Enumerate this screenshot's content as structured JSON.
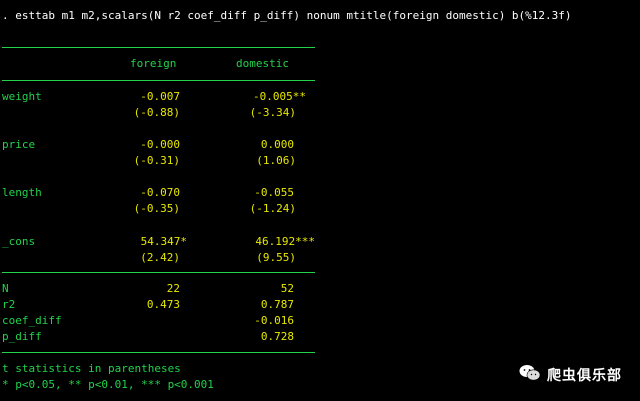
{
  "command": ". esttab m1 m2,scalars(N r2 coef_diff p_diff) nonum mtitle(foreign domestic) b(%12.3f)",
  "columns": [
    "foreign",
    "domestic"
  ],
  "rows": [
    {
      "name": "weight",
      "coef": [
        "-0.007",
        "-0.005**"
      ],
      "tstat": [
        "(-0.88)",
        "(-3.34)"
      ]
    },
    {
      "name": "price",
      "coef": [
        "-0.000",
        "0.000"
      ],
      "tstat": [
        "(-0.31)",
        "(1.06)"
      ]
    },
    {
      "name": "length",
      "coef": [
        "-0.070",
        "-0.055"
      ],
      "tstat": [
        "(-0.35)",
        "(-1.24)"
      ]
    },
    {
      "name": "_cons",
      "coef": [
        "54.347*",
        "46.192***"
      ],
      "tstat": [
        "(2.42)",
        "(9.55)"
      ]
    }
  ],
  "scalars": [
    {
      "name": "N",
      "values": [
        "22",
        "52"
      ]
    },
    {
      "name": "r2",
      "values": [
        "0.473",
        "0.787"
      ]
    },
    {
      "name": "coef_diff",
      "values": [
        "",
        "-0.016"
      ]
    },
    {
      "name": "p_diff",
      "values": [
        "",
        "0.728"
      ]
    }
  ],
  "footer": [
    "t statistics in parentheses",
    "* p<0.05, ** p<0.01, *** p<0.001"
  ],
  "watermark": "爬虫俱乐部",
  "colors": {
    "background": "#000000",
    "label": "#22d24a",
    "value": "#e8e800",
    "command": "#ffffff"
  }
}
